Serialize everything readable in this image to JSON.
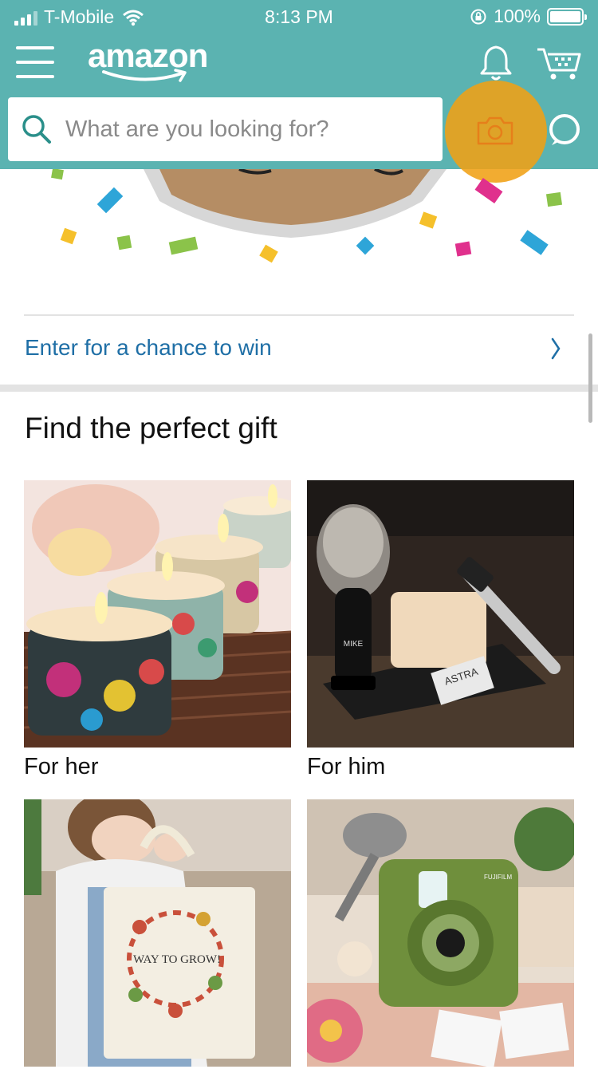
{
  "status_bar": {
    "carrier": "T-Mobile",
    "time": "8:13 PM",
    "battery": "100%"
  },
  "header": {
    "logo": "amazon",
    "search_placeholder": "What are you looking for?",
    "background_color": "#5bb3b1"
  },
  "promo": {
    "link_text": "Enter for a chance to win",
    "link_color": "#1f6fa6"
  },
  "gift_section": {
    "title": "Find the perfect gift",
    "tiles": [
      {
        "label": "For her"
      },
      {
        "label": "For him"
      },
      {
        "label": ""
      },
      {
        "label": ""
      }
    ]
  },
  "image_text": {
    "brush_brand": "MIKE",
    "blade_brand": "ASTRA",
    "bag_text": "WAY TO GROW!",
    "camera_brand": "FUJIFILM"
  },
  "icons": [
    "menu-icon",
    "bell-icon",
    "cart-icon",
    "search-icon",
    "camera-icon",
    "alexa-icon",
    "chevron-right-icon"
  ]
}
